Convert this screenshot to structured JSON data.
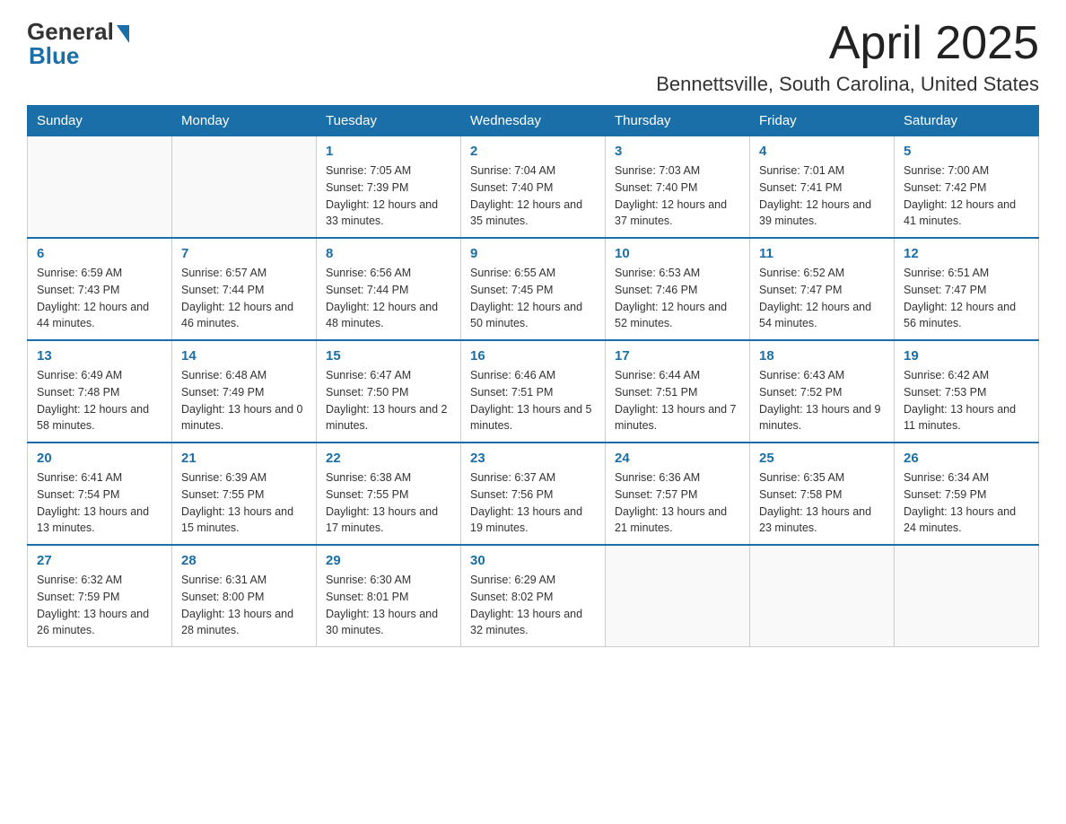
{
  "header": {
    "logo_general": "General",
    "logo_blue": "Blue",
    "month": "April 2025",
    "location": "Bennettsville, South Carolina, United States"
  },
  "days_of_week": [
    "Sunday",
    "Monday",
    "Tuesday",
    "Wednesday",
    "Thursday",
    "Friday",
    "Saturday"
  ],
  "weeks": [
    [
      {
        "day": "",
        "sunrise": "",
        "sunset": "",
        "daylight": ""
      },
      {
        "day": "",
        "sunrise": "",
        "sunset": "",
        "daylight": ""
      },
      {
        "day": "1",
        "sunrise": "Sunrise: 7:05 AM",
        "sunset": "Sunset: 7:39 PM",
        "daylight": "Daylight: 12 hours and 33 minutes."
      },
      {
        "day": "2",
        "sunrise": "Sunrise: 7:04 AM",
        "sunset": "Sunset: 7:40 PM",
        "daylight": "Daylight: 12 hours and 35 minutes."
      },
      {
        "day": "3",
        "sunrise": "Sunrise: 7:03 AM",
        "sunset": "Sunset: 7:40 PM",
        "daylight": "Daylight: 12 hours and 37 minutes."
      },
      {
        "day": "4",
        "sunrise": "Sunrise: 7:01 AM",
        "sunset": "Sunset: 7:41 PM",
        "daylight": "Daylight: 12 hours and 39 minutes."
      },
      {
        "day": "5",
        "sunrise": "Sunrise: 7:00 AM",
        "sunset": "Sunset: 7:42 PM",
        "daylight": "Daylight: 12 hours and 41 minutes."
      }
    ],
    [
      {
        "day": "6",
        "sunrise": "Sunrise: 6:59 AM",
        "sunset": "Sunset: 7:43 PM",
        "daylight": "Daylight: 12 hours and 44 minutes."
      },
      {
        "day": "7",
        "sunrise": "Sunrise: 6:57 AM",
        "sunset": "Sunset: 7:44 PM",
        "daylight": "Daylight: 12 hours and 46 minutes."
      },
      {
        "day": "8",
        "sunrise": "Sunrise: 6:56 AM",
        "sunset": "Sunset: 7:44 PM",
        "daylight": "Daylight: 12 hours and 48 minutes."
      },
      {
        "day": "9",
        "sunrise": "Sunrise: 6:55 AM",
        "sunset": "Sunset: 7:45 PM",
        "daylight": "Daylight: 12 hours and 50 minutes."
      },
      {
        "day": "10",
        "sunrise": "Sunrise: 6:53 AM",
        "sunset": "Sunset: 7:46 PM",
        "daylight": "Daylight: 12 hours and 52 minutes."
      },
      {
        "day": "11",
        "sunrise": "Sunrise: 6:52 AM",
        "sunset": "Sunset: 7:47 PM",
        "daylight": "Daylight: 12 hours and 54 minutes."
      },
      {
        "day": "12",
        "sunrise": "Sunrise: 6:51 AM",
        "sunset": "Sunset: 7:47 PM",
        "daylight": "Daylight: 12 hours and 56 minutes."
      }
    ],
    [
      {
        "day": "13",
        "sunrise": "Sunrise: 6:49 AM",
        "sunset": "Sunset: 7:48 PM",
        "daylight": "Daylight: 12 hours and 58 minutes."
      },
      {
        "day": "14",
        "sunrise": "Sunrise: 6:48 AM",
        "sunset": "Sunset: 7:49 PM",
        "daylight": "Daylight: 13 hours and 0 minutes."
      },
      {
        "day": "15",
        "sunrise": "Sunrise: 6:47 AM",
        "sunset": "Sunset: 7:50 PM",
        "daylight": "Daylight: 13 hours and 2 minutes."
      },
      {
        "day": "16",
        "sunrise": "Sunrise: 6:46 AM",
        "sunset": "Sunset: 7:51 PM",
        "daylight": "Daylight: 13 hours and 5 minutes."
      },
      {
        "day": "17",
        "sunrise": "Sunrise: 6:44 AM",
        "sunset": "Sunset: 7:51 PM",
        "daylight": "Daylight: 13 hours and 7 minutes."
      },
      {
        "day": "18",
        "sunrise": "Sunrise: 6:43 AM",
        "sunset": "Sunset: 7:52 PM",
        "daylight": "Daylight: 13 hours and 9 minutes."
      },
      {
        "day": "19",
        "sunrise": "Sunrise: 6:42 AM",
        "sunset": "Sunset: 7:53 PM",
        "daylight": "Daylight: 13 hours and 11 minutes."
      }
    ],
    [
      {
        "day": "20",
        "sunrise": "Sunrise: 6:41 AM",
        "sunset": "Sunset: 7:54 PM",
        "daylight": "Daylight: 13 hours and 13 minutes."
      },
      {
        "day": "21",
        "sunrise": "Sunrise: 6:39 AM",
        "sunset": "Sunset: 7:55 PM",
        "daylight": "Daylight: 13 hours and 15 minutes."
      },
      {
        "day": "22",
        "sunrise": "Sunrise: 6:38 AM",
        "sunset": "Sunset: 7:55 PM",
        "daylight": "Daylight: 13 hours and 17 minutes."
      },
      {
        "day": "23",
        "sunrise": "Sunrise: 6:37 AM",
        "sunset": "Sunset: 7:56 PM",
        "daylight": "Daylight: 13 hours and 19 minutes."
      },
      {
        "day": "24",
        "sunrise": "Sunrise: 6:36 AM",
        "sunset": "Sunset: 7:57 PM",
        "daylight": "Daylight: 13 hours and 21 minutes."
      },
      {
        "day": "25",
        "sunrise": "Sunrise: 6:35 AM",
        "sunset": "Sunset: 7:58 PM",
        "daylight": "Daylight: 13 hours and 23 minutes."
      },
      {
        "day": "26",
        "sunrise": "Sunrise: 6:34 AM",
        "sunset": "Sunset: 7:59 PM",
        "daylight": "Daylight: 13 hours and 24 minutes."
      }
    ],
    [
      {
        "day": "27",
        "sunrise": "Sunrise: 6:32 AM",
        "sunset": "Sunset: 7:59 PM",
        "daylight": "Daylight: 13 hours and 26 minutes."
      },
      {
        "day": "28",
        "sunrise": "Sunrise: 6:31 AM",
        "sunset": "Sunset: 8:00 PM",
        "daylight": "Daylight: 13 hours and 28 minutes."
      },
      {
        "day": "29",
        "sunrise": "Sunrise: 6:30 AM",
        "sunset": "Sunset: 8:01 PM",
        "daylight": "Daylight: 13 hours and 30 minutes."
      },
      {
        "day": "30",
        "sunrise": "Sunrise: 6:29 AM",
        "sunset": "Sunset: 8:02 PM",
        "daylight": "Daylight: 13 hours and 32 minutes."
      },
      {
        "day": "",
        "sunrise": "",
        "sunset": "",
        "daylight": ""
      },
      {
        "day": "",
        "sunrise": "",
        "sunset": "",
        "daylight": ""
      },
      {
        "day": "",
        "sunrise": "",
        "sunset": "",
        "daylight": ""
      }
    ]
  ]
}
